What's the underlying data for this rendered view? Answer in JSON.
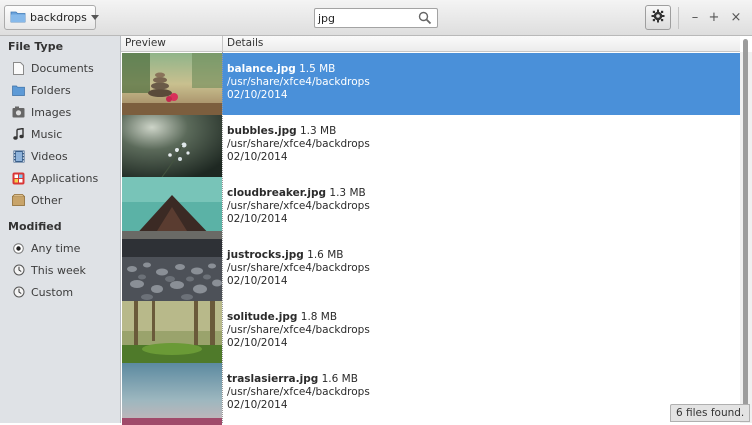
{
  "header": {
    "folder_label": "backdrops",
    "search_value": "jpg"
  },
  "sidebar": {
    "file_type_title": "File Type",
    "file_types": [
      {
        "label": "Documents",
        "icon": "document-icon"
      },
      {
        "label": "Folders",
        "icon": "folder-icon"
      },
      {
        "label": "Images",
        "icon": "image-icon"
      },
      {
        "label": "Music",
        "icon": "music-note-icon"
      },
      {
        "label": "Videos",
        "icon": "film-icon"
      },
      {
        "label": "Applications",
        "icon": "applications-icon"
      },
      {
        "label": "Other",
        "icon": "other-icon"
      }
    ],
    "modified_title": "Modified",
    "modified": [
      {
        "label": "Any time",
        "icon": "radio-selected-icon",
        "selected": true
      },
      {
        "label": "This week",
        "icon": "clock-icon",
        "selected": false
      },
      {
        "label": "Custom",
        "icon": "clock-icon",
        "selected": false
      }
    ]
  },
  "columns": {
    "preview": "Preview",
    "details": "Details"
  },
  "results": [
    {
      "name": "balance.jpg",
      "size": "1.5 MB",
      "path": "/usr/share/xfce4/backdrops",
      "date": "02/10/2014",
      "selected": true
    },
    {
      "name": "bubbles.jpg",
      "size": "1.3 MB",
      "path": "/usr/share/xfce4/backdrops",
      "date": "02/10/2014",
      "selected": false
    },
    {
      "name": "cloudbreaker.jpg",
      "size": "1.3 MB",
      "path": "/usr/share/xfce4/backdrops",
      "date": "02/10/2014",
      "selected": false
    },
    {
      "name": "justrocks.jpg",
      "size": "1.6 MB",
      "path": "/usr/share/xfce4/backdrops",
      "date": "02/10/2014",
      "selected": false
    },
    {
      "name": "solitude.jpg",
      "size": "1.8 MB",
      "path": "/usr/share/xfce4/backdrops",
      "date": "02/10/2014",
      "selected": false
    },
    {
      "name": "traslasierra.jpg",
      "size": "1.6 MB",
      "path": "/usr/share/xfce4/backdrops",
      "date": "02/10/2014",
      "selected": false
    }
  ],
  "status": "6 files found.",
  "colors": {
    "selection": "#4a90d9",
    "sidebar": "#dfe2e6"
  }
}
